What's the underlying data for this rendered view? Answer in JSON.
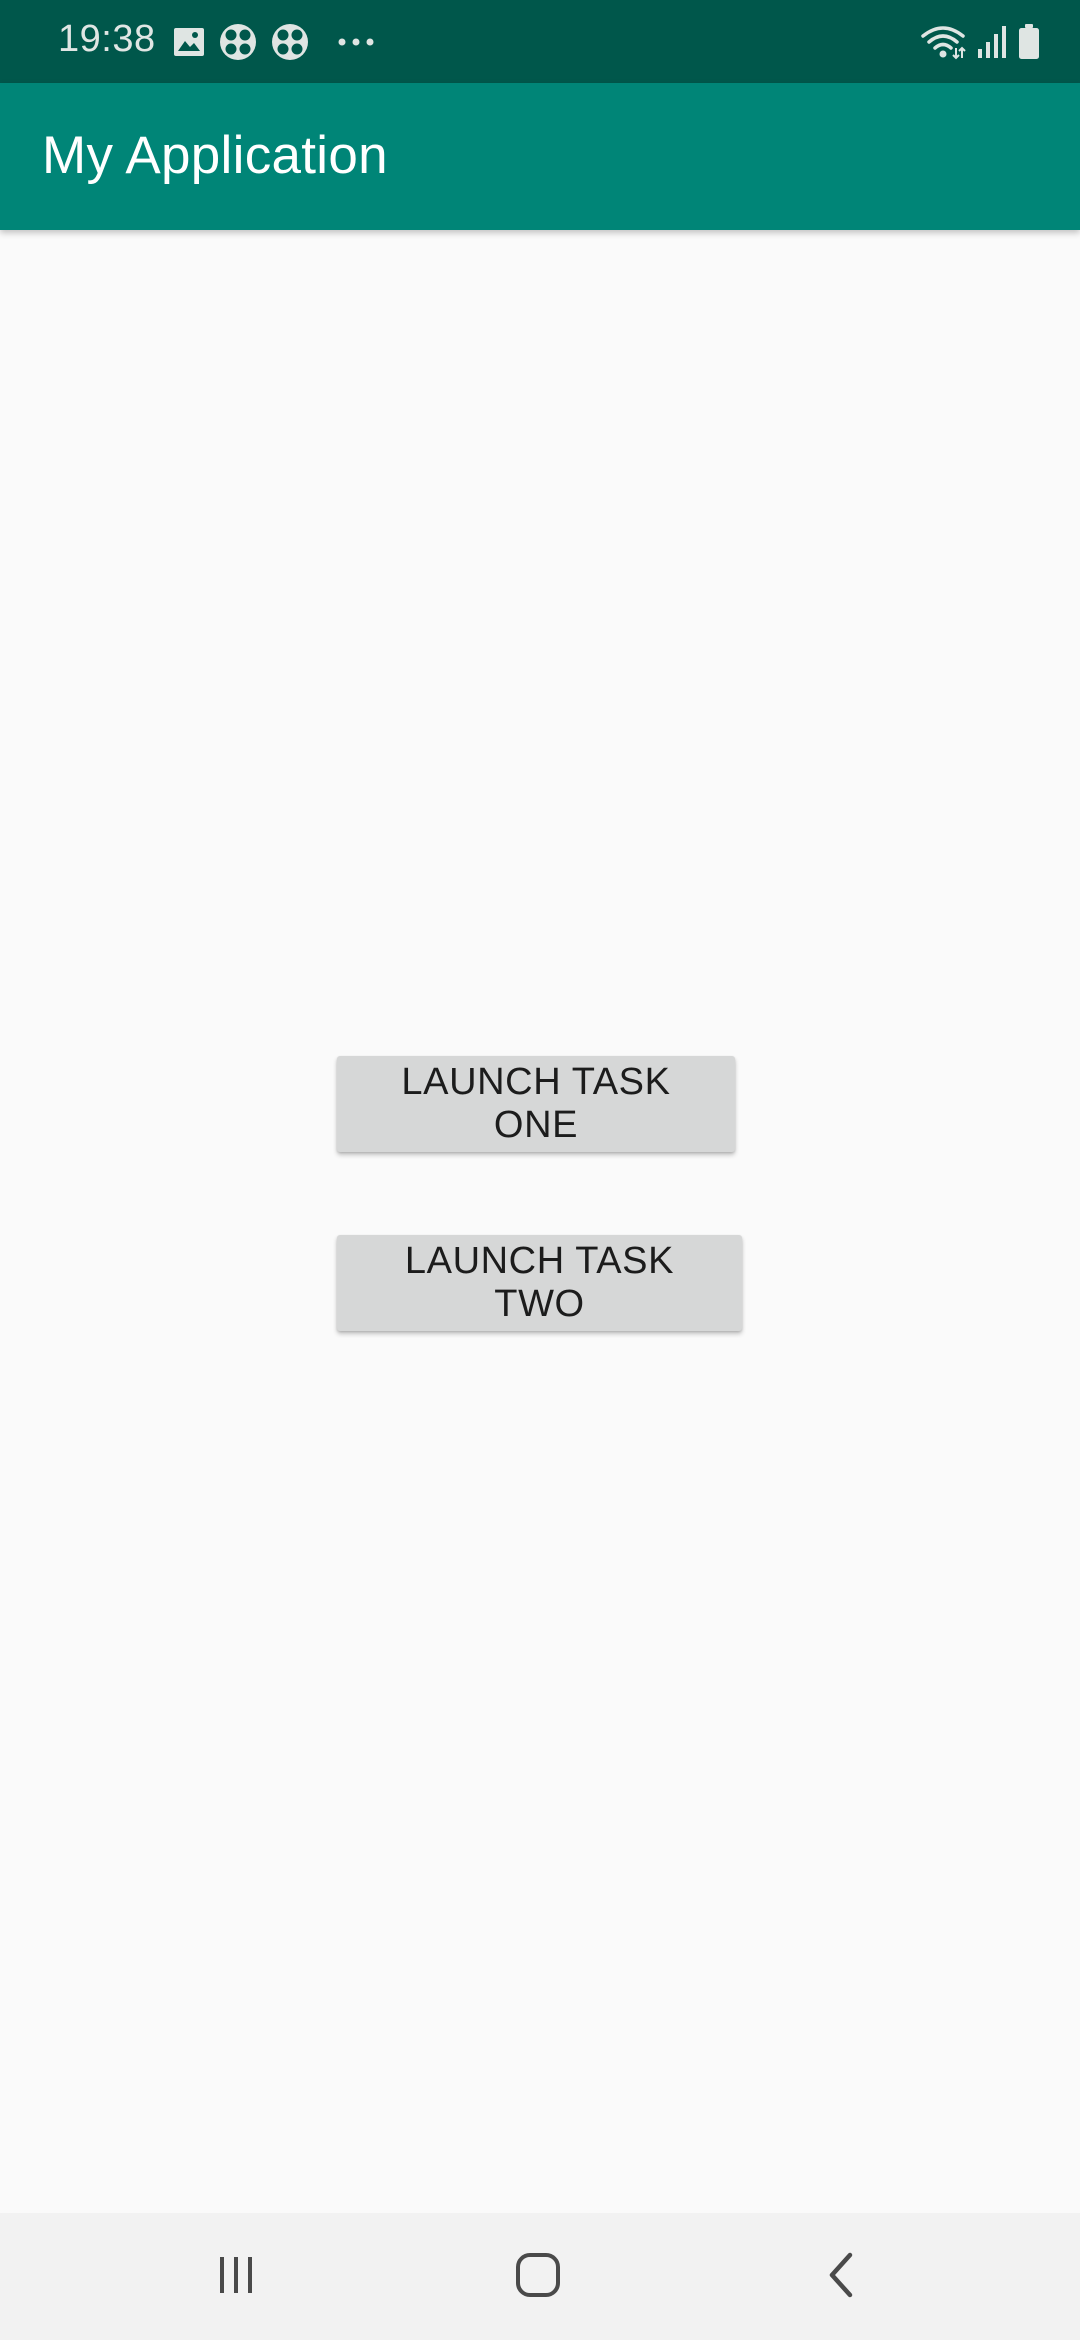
{
  "status_bar": {
    "time": "19:38",
    "left_icons": [
      "image-icon",
      "pinwheel-icon",
      "pinwheel-icon",
      "more-dots-icon"
    ],
    "right_icons": [
      "wifi-icon",
      "signal-icon",
      "battery-icon"
    ]
  },
  "app_bar": {
    "title": "My Application",
    "color": "#008577"
  },
  "buttons": {
    "task_one_label": "LAUNCH TASK ONE",
    "task_two_label": "LAUNCH TASK TWO"
  },
  "nav_bar": {
    "items": [
      "recents-icon",
      "home-icon",
      "back-icon"
    ]
  },
  "colors": {
    "status_bar": "#00574b",
    "app_bar": "#008577",
    "background": "#fafafa",
    "button": "#d6d7d7",
    "nav_bar": "#f2f2f2"
  }
}
